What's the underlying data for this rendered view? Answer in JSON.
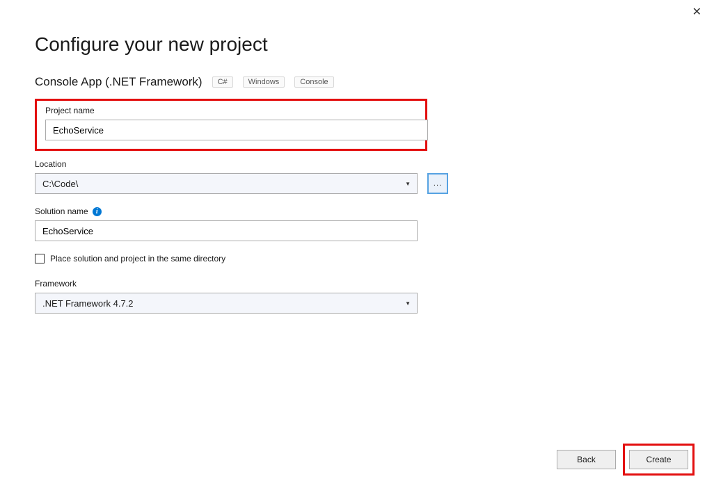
{
  "header": {
    "title": "Configure your new project",
    "subtitle": "Console App (.NET Framework)",
    "tags": [
      "C#",
      "Windows",
      "Console"
    ]
  },
  "fields": {
    "projectName": {
      "label": "Project name",
      "value": "EchoService"
    },
    "location": {
      "label": "Location",
      "value": "C:\\Code\\",
      "browse": "..."
    },
    "solutionName": {
      "label": "Solution name",
      "value": "EchoService"
    },
    "sameDirCheckbox": "Place solution and project in the same directory",
    "framework": {
      "label": "Framework",
      "value": ".NET Framework 4.7.2"
    }
  },
  "footer": {
    "back": "Back",
    "create": "Create"
  }
}
